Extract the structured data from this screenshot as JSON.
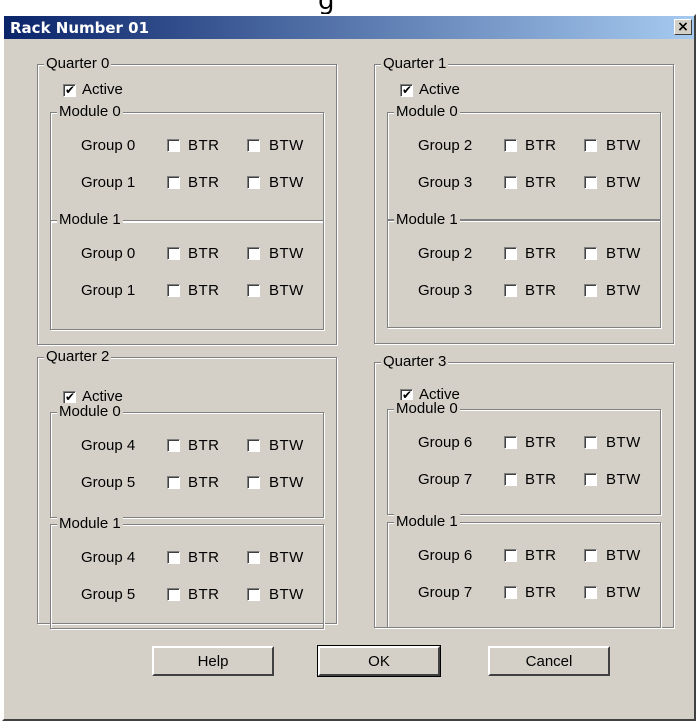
{
  "dialog": {
    "title": "Rack Number 01",
    "close_label": "×",
    "buttons": {
      "help": "Help",
      "ok": "OK",
      "cancel": "Cancel"
    }
  },
  "quarters": [
    {
      "title": "Quarter 0",
      "active_label": "Active",
      "active_checked": true,
      "modules": [
        {
          "title": "Module 0",
          "groups": [
            {
              "label": "Group 0",
              "btr": "BTR",
              "btw": "BTW"
            },
            {
              "label": "Group 1",
              "btr": "BTR",
              "btw": "BTW"
            }
          ]
        },
        {
          "title": "Module 1",
          "groups": [
            {
              "label": "Group 0",
              "btr": "BTR",
              "btw": "BTW"
            },
            {
              "label": "Group 1",
              "btr": "BTR",
              "btw": "BTW"
            }
          ]
        }
      ]
    },
    {
      "title": "Quarter 1",
      "active_label": "Active",
      "active_checked": true,
      "modules": [
        {
          "title": "Module 0",
          "groups": [
            {
              "label": "Group 2",
              "btr": "BTR",
              "btw": "BTW"
            },
            {
              "label": "Group 3",
              "btr": "BTR",
              "btw": "BTW"
            }
          ]
        },
        {
          "title": "Module 1",
          "groups": [
            {
              "label": "Group 2",
              "btr": "BTR",
              "btw": "BTW"
            },
            {
              "label": "Group 3",
              "btr": "BTR",
              "btw": "BTW"
            }
          ]
        }
      ]
    },
    {
      "title": "Quarter 2",
      "active_label": "Active",
      "active_checked": true,
      "modules": [
        {
          "title": "Module 0",
          "groups": [
            {
              "label": "Group 4",
              "btr": "BTR",
              "btw": "BTW"
            },
            {
              "label": "Group 5",
              "btr": "BTR",
              "btw": "BTW"
            }
          ]
        },
        {
          "title": "Module 1",
          "groups": [
            {
              "label": "Group 4",
              "btr": "BTR",
              "btw": "BTW"
            },
            {
              "label": "Group 5",
              "btr": "BTR",
              "btw": "BTW"
            }
          ]
        }
      ]
    },
    {
      "title": "Quarter 3",
      "active_label": "Active",
      "active_checked": true,
      "modules": [
        {
          "title": "Module 0",
          "groups": [
            {
              "label": "Group 6",
              "btr": "BTR",
              "btw": "BTW"
            },
            {
              "label": "Group 7",
              "btr": "BTR",
              "btw": "BTW"
            }
          ]
        },
        {
          "title": "Module 1",
          "groups": [
            {
              "label": "Group 6",
              "btr": "BTR",
              "btw": "BTW"
            },
            {
              "label": "Group 7",
              "btr": "BTR",
              "btw": "BTW"
            }
          ]
        }
      ]
    }
  ]
}
